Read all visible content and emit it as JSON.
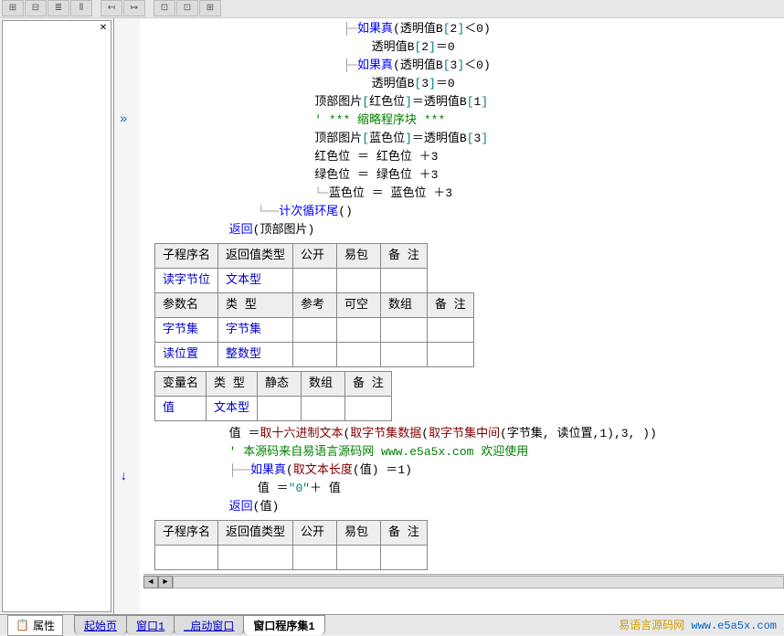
{
  "toolbar": {
    "buttons": [
      "⊞",
      "⊟",
      "≣",
      "⫴",
      "↤",
      "↦",
      "⊡",
      "⊡",
      "⊞"
    ]
  },
  "gutter_marks": {
    "bookmark_line": 5,
    "arrow_line": 22
  },
  "code": {
    "lines": [
      {
        "indent": 7,
        "tree": "├─",
        "tokens": [
          {
            "t": "kw",
            "v": "如果真"
          },
          {
            "t": "op",
            "v": " ("
          },
          {
            "t": "var",
            "v": "透明值B "
          },
          {
            "t": "bracket",
            "v": "["
          },
          {
            "t": "num",
            "v": "2"
          },
          {
            "t": "bracket",
            "v": "]"
          },
          {
            "t": "op",
            "v": " ＜ "
          },
          {
            "t": "num",
            "v": "0"
          },
          {
            "t": "op",
            "v": ")"
          }
        ]
      },
      {
        "indent": 8,
        "tree": "",
        "tokens": [
          {
            "t": "var",
            "v": "透明值B "
          },
          {
            "t": "bracket",
            "v": "["
          },
          {
            "t": "num",
            "v": "2"
          },
          {
            "t": "bracket",
            "v": "]"
          },
          {
            "t": "op",
            "v": " ＝ "
          },
          {
            "t": "num",
            "v": "0"
          }
        ]
      },
      {
        "indent": 7,
        "tree": "├─",
        "tokens": [
          {
            "t": "kw",
            "v": "如果真"
          },
          {
            "t": "op",
            "v": " ("
          },
          {
            "t": "var",
            "v": "透明值B "
          },
          {
            "t": "bracket",
            "v": "["
          },
          {
            "t": "num",
            "v": "3"
          },
          {
            "t": "bracket",
            "v": "]"
          },
          {
            "t": "op",
            "v": " ＜ "
          },
          {
            "t": "num",
            "v": "0"
          },
          {
            "t": "op",
            "v": ")"
          }
        ]
      },
      {
        "indent": 8,
        "tree": "",
        "tokens": [
          {
            "t": "var",
            "v": "透明值B "
          },
          {
            "t": "bracket",
            "v": "["
          },
          {
            "t": "num",
            "v": "3"
          },
          {
            "t": "bracket",
            "v": "]"
          },
          {
            "t": "op",
            "v": " ＝ "
          },
          {
            "t": "num",
            "v": "0"
          }
        ]
      },
      {
        "indent": 6,
        "tree": "",
        "tokens": [
          {
            "t": "var",
            "v": "顶部图片 "
          },
          {
            "t": "bracket",
            "v": "["
          },
          {
            "t": "var",
            "v": "红色位"
          },
          {
            "t": "bracket",
            "v": "]"
          },
          {
            "t": "op",
            "v": " ＝ "
          },
          {
            "t": "var",
            "v": "透明值B "
          },
          {
            "t": "bracket",
            "v": "["
          },
          {
            "t": "num",
            "v": "1"
          },
          {
            "t": "bracket",
            "v": "]"
          }
        ]
      },
      {
        "indent": 6,
        "tree": "",
        "tokens": [
          {
            "t": "comment",
            "v": "' *** 缩略程序块 ***"
          }
        ]
      },
      {
        "indent": 6,
        "tree": "",
        "tokens": [
          {
            "t": "var",
            "v": "顶部图片 "
          },
          {
            "t": "bracket",
            "v": "["
          },
          {
            "t": "var",
            "v": "蓝色位"
          },
          {
            "t": "bracket",
            "v": "]"
          },
          {
            "t": "op",
            "v": " ＝ "
          },
          {
            "t": "var",
            "v": "透明值B "
          },
          {
            "t": "bracket",
            "v": "["
          },
          {
            "t": "num",
            "v": "3"
          },
          {
            "t": "bracket",
            "v": "]"
          }
        ]
      },
      {
        "indent": 6,
        "tree": "",
        "tokens": [
          {
            "t": "var",
            "v": "红色位 ＝ 红色位 ＋ "
          },
          {
            "t": "num",
            "v": "3"
          }
        ]
      },
      {
        "indent": 6,
        "tree": "",
        "tokens": [
          {
            "t": "var",
            "v": "绿色位 ＝ 绿色位 ＋ "
          },
          {
            "t": "num",
            "v": "3"
          }
        ]
      },
      {
        "indent": 6,
        "tree": "└─",
        "tokens": [
          {
            "t": "var",
            "v": "蓝色位 ＝ 蓝色位 ＋ "
          },
          {
            "t": "num",
            "v": "3"
          }
        ]
      },
      {
        "indent": 4,
        "tree": "└──",
        "tokens": [
          {
            "t": "kw",
            "v": "计次循环尾"
          },
          {
            "t": "op",
            "v": " ()"
          }
        ]
      },
      {
        "indent": 3,
        "tree": "",
        "tokens": [
          {
            "t": "kw",
            "v": "返回"
          },
          {
            "t": "op",
            "v": " ("
          },
          {
            "t": "var",
            "v": "顶部图片"
          },
          {
            "t": "op",
            "v": ")"
          }
        ]
      }
    ],
    "expr_line": {
      "tokens": [
        {
          "t": "var",
          "v": "值 ＝ "
        },
        {
          "t": "fn",
          "v": "取十六进制文本"
        },
        {
          "t": "op",
          "v": " ("
        },
        {
          "t": "fn",
          "v": "取字节集数据"
        },
        {
          "t": "op",
          "v": " ("
        },
        {
          "t": "fn",
          "v": "取字节集中间"
        },
        {
          "t": "op",
          "v": " ("
        },
        {
          "t": "var",
          "v": "字节集, 读位置, "
        },
        {
          "t": "num",
          "v": "1"
        },
        {
          "t": "op",
          "v": "), "
        },
        {
          "t": "num",
          "v": "3"
        },
        {
          "t": "op",
          "v": ", ))"
        }
      ]
    },
    "comment_line": "' 本源码来自易语言源码网 www.e5a5x.com  欢迎使用",
    "if_line": {
      "tokens": [
        {
          "t": "kw",
          "v": "如果真"
        },
        {
          "t": "op",
          "v": " ("
        },
        {
          "t": "fn",
          "v": "取文本长度"
        },
        {
          "t": "op",
          "v": " ("
        },
        {
          "t": "var",
          "v": "值"
        },
        {
          "t": "op",
          "v": ") ＝ "
        },
        {
          "t": "num",
          "v": "1"
        },
        {
          "t": "op",
          "v": ")"
        }
      ]
    },
    "assign_line": {
      "tokens": [
        {
          "t": "var",
          "v": "值 ＝ "
        },
        {
          "t": "str",
          "v": "\"0\""
        },
        {
          "t": "var",
          "v": " ＋ 值"
        }
      ]
    },
    "return_line": {
      "tokens": [
        {
          "t": "kw",
          "v": "返回"
        },
        {
          "t": "op",
          "v": " ("
        },
        {
          "t": "var",
          "v": "值"
        },
        {
          "t": "op",
          "v": ")"
        }
      ]
    }
  },
  "table1": {
    "headers1": [
      "子程序名",
      "返回值类型",
      "公开",
      "易包",
      "备 注"
    ],
    "row1": [
      "读字节位",
      "文本型",
      "",
      "",
      ""
    ],
    "headers2": [
      "参数名",
      "类 型",
      "参考",
      "可空",
      "数组",
      "备 注"
    ],
    "rows2": [
      [
        "字节集",
        "字节集",
        "",
        "",
        "",
        ""
      ],
      [
        "读位置",
        "整数型",
        "",
        "",
        "",
        ""
      ]
    ]
  },
  "table2": {
    "headers": [
      "变量名",
      "类 型",
      "静态",
      "数组",
      "备 注"
    ],
    "row": [
      "值",
      "文本型",
      "",
      "",
      ""
    ]
  },
  "table3": {
    "headers": [
      "子程序名",
      "返回值类型",
      "公开",
      "易包",
      "备 注"
    ],
    "row": [
      "",
      "",
      "",
      "",
      ""
    ]
  },
  "bottom": {
    "prop_label": "属性",
    "tabs": [
      "起始页",
      "窗口1",
      "_启动窗口",
      "窗口程序集1"
    ],
    "active_tab": 3
  },
  "footer": {
    "cn": "易语言源码网",
    "url": "www.e5a5x.com"
  }
}
